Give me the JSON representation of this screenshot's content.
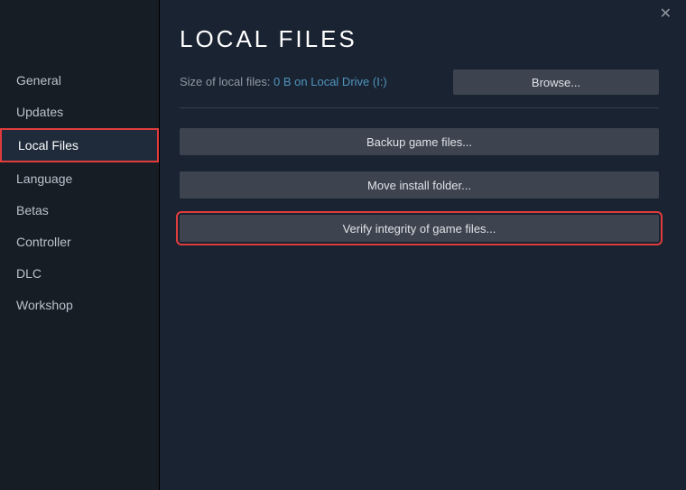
{
  "sidebar": {
    "items": [
      {
        "label": "General"
      },
      {
        "label": "Updates"
      },
      {
        "label": "Local Files"
      },
      {
        "label": "Language"
      },
      {
        "label": "Betas"
      },
      {
        "label": "Controller"
      },
      {
        "label": "DLC"
      },
      {
        "label": "Workshop"
      }
    ]
  },
  "main": {
    "title": "LOCAL FILES",
    "size_label": "Size of local files: ",
    "size_value": "0 B on Local Drive (I:)",
    "browse_label": "Browse...",
    "actions": {
      "backup": "Backup game files...",
      "move": "Move install folder...",
      "verify": "Verify integrity of game files..."
    }
  }
}
